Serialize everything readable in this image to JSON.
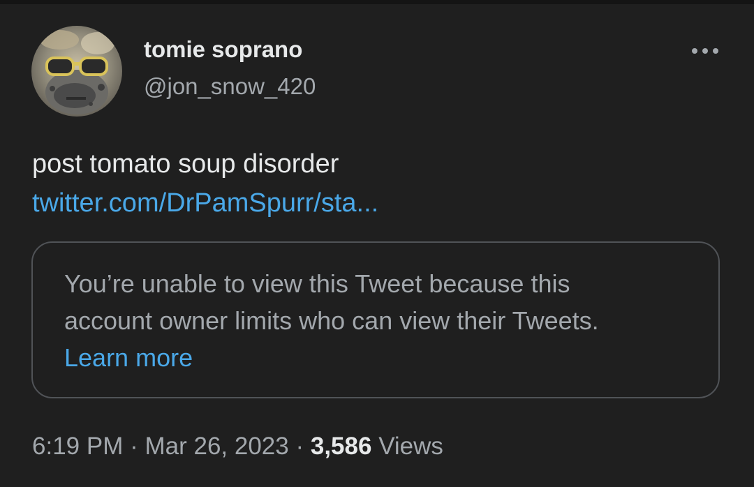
{
  "tweet": {
    "author": {
      "display_name": "tomie soprano",
      "handle": "@jon_snow_420"
    },
    "more_icon": "more-horizontal-icon",
    "text": "post tomato soup disorder",
    "link": "twitter.com/DrPamSpurr/sta...",
    "quoted_notice": {
      "line1": "You’re unable to view this Tweet because this",
      "line2": "account owner limits who can view their Tweets.",
      "learn_more": "Learn more"
    },
    "meta": {
      "time": "6:19 PM",
      "separator": "·",
      "date": "Mar 26, 2023",
      "views_count": "3,586",
      "views_label": "Views"
    }
  },
  "colors": {
    "background": "#1f1f1f",
    "primary_text": "#e7e9ea",
    "secondary_text": "#a3a8ad",
    "link": "#4aa8e8",
    "card_border": "#505357"
  }
}
